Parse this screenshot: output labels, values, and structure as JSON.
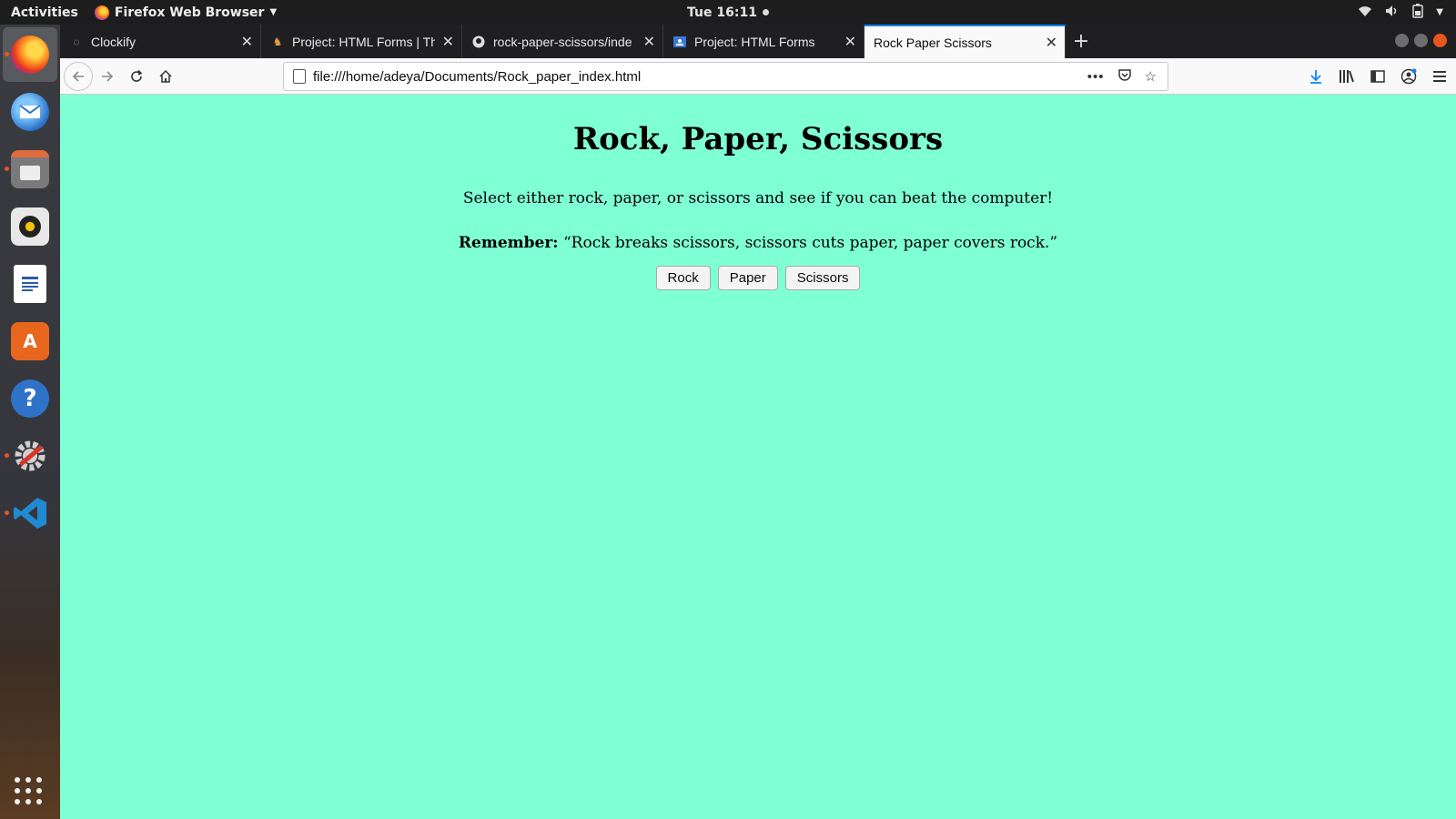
{
  "system_bar": {
    "activities": "Activities",
    "app_name": "Firefox Web Browser",
    "clock": "Tue 16:11"
  },
  "dock": {
    "items": [
      {
        "name": "firefox",
        "icon": "firefox-icon",
        "active": true
      },
      {
        "name": "thunderbird",
        "icon": "thunderbird-icon"
      },
      {
        "name": "files",
        "icon": "files-icon"
      },
      {
        "name": "rhythmbox",
        "icon": "speaker-icon"
      },
      {
        "name": "writer",
        "icon": "writer-icon"
      },
      {
        "name": "software",
        "icon": "store-icon"
      },
      {
        "name": "help",
        "icon": "help-icon"
      },
      {
        "name": "settings",
        "icon": "settings-icon"
      },
      {
        "name": "vscode",
        "icon": "vscode-icon"
      }
    ]
  },
  "browser": {
    "tabs": [
      {
        "label": "Clockify",
        "selected": false
      },
      {
        "label": "Project: HTML Forms | Th",
        "selected": false
      },
      {
        "label": "rock-paper-scissors/inde",
        "selected": false
      },
      {
        "label": "Project: HTML Forms",
        "selected": false
      },
      {
        "label": "Rock Paper Scissors",
        "selected": true
      }
    ],
    "url": "file:///home/adeya/Documents/Rock_paper_index.html"
  },
  "page": {
    "title": "Rock, Paper, Scissors",
    "intro": "Select either rock, paper, or scissors and see if you can beat the computer!",
    "remember_label": "Remember:",
    "remember_text": "“Rock breaks scissors, scissors cuts paper, paper covers rock.”",
    "buttons": [
      "Rock",
      "Paper",
      "Scissors"
    ],
    "background_color": "#7fffd4"
  }
}
